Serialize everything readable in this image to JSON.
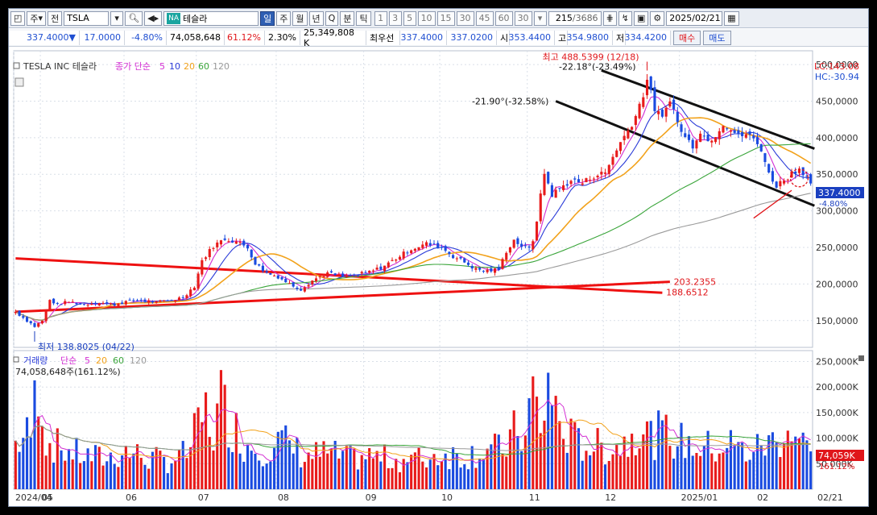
{
  "toolbar": {
    "period_label": "주",
    "prev_label": "전",
    "symbol": "TSLA",
    "na_badge": "NA",
    "name": "테슬라",
    "periods": [
      "일",
      "주",
      "월",
      "년",
      "Q",
      "분",
      "틱"
    ],
    "selected_period": "일",
    "intervals": [
      "1",
      "3",
      "5",
      "10",
      "15",
      "30",
      "45",
      "60",
      "30"
    ],
    "bar_count": "215",
    "bar_total": "/3686",
    "date": "2025/02/21"
  },
  "quote": {
    "price": "337.4000",
    "change": "17.0000",
    "change_pct": "-4.80%",
    "volume": "74,058,648",
    "vol_ratio": "61.12%",
    "turnover": "2.30%",
    "amount": "25,349,808 K",
    "best_label": "최우선",
    "ask": "337.4000",
    "bid": "337.0200",
    "open_label": "시",
    "open": "353.4400",
    "high_label": "고",
    "high": "354.9800",
    "low_label": "저",
    "low": "334.4200",
    "buy_label": "매수",
    "sell_label": "매도"
  },
  "colors": {
    "up": "#e81b1b",
    "down": "#1a4be0",
    "ma5": "#d32fd3",
    "ma10": "#2a3bd8",
    "ma20": "#f2a21b",
    "ma60": "#3aa53a",
    "ma120": "#9a9a9a"
  },
  "price_panel": {
    "title": "TESLA INC  테슬라",
    "ma_label": "종가 단순",
    "ma_periods": [
      "5",
      "10",
      "20",
      "60",
      "120"
    ],
    "lc": "LC:143.08",
    "hc": "HC:-30.94",
    "current_price": "337.4000",
    "current_pct": "-4.80%",
    "annot_high": "최고 488.5399 (12/18)",
    "annot_low": "최저 138.8025 (04/22)",
    "annot_ch1": "-22.18°(-23.49%)",
    "annot_ch2": "-21.90°(-32.58%)",
    "annot_l1": "203.2355",
    "annot_l2": "188.6512"
  },
  "volume_panel": {
    "title": "거래량",
    "ma_label": "단순",
    "ma_periods": [
      "5",
      "20",
      "60",
      "120"
    ],
    "value_text": "74,058,648주(161.12%)",
    "current_label": "74,059K",
    "current_pct": "161.12%",
    "y_labels": [
      "250,000K",
      "200,000K",
      "150,000K",
      "100,000K",
      "50,000K"
    ]
  },
  "x_labels": [
    "2024/04",
    "05",
    "06",
    "07",
    "08",
    "09",
    "10",
    "11",
    "12",
    "2025/01",
    "02",
    "02/21"
  ],
  "chart_data": {
    "type": "candlestick",
    "title": "TESLA INC  테슬라",
    "ylim": [
      120,
      510
    ],
    "y_ticks": [
      150,
      200,
      250,
      300,
      350,
      400,
      450,
      500
    ],
    "vol_ylim": [
      0,
      265000
    ],
    "vol_ticks": [
      50000,
      100000,
      150000,
      200000,
      250000
    ],
    "months": [
      {
        "label": "2024/04",
        "start": 0
      },
      {
        "label": "05",
        "start": 7
      },
      {
        "label": "06",
        "start": 29
      },
      {
        "label": "07",
        "start": 48
      },
      {
        "label": "08",
        "start": 69
      },
      {
        "label": "09",
        "start": 92
      },
      {
        "label": "10",
        "start": 112
      },
      {
        "label": "11",
        "start": 135
      },
      {
        "label": "12",
        "start": 155
      },
      {
        "label": "2025/01",
        "start": 175
      },
      {
        "label": "02",
        "start": 195
      }
    ],
    "close_path": [
      [
        0,
        162
      ],
      [
        3,
        150
      ],
      [
        5,
        142
      ],
      [
        7,
        150
      ],
      [
        9,
        178
      ],
      [
        11,
        172
      ],
      [
        14,
        176
      ],
      [
        18,
        172
      ],
      [
        22,
        175
      ],
      [
        26,
        172
      ],
      [
        29,
        176
      ],
      [
        33,
        178
      ],
      [
        37,
        175
      ],
      [
        41,
        178
      ],
      [
        44,
        182
      ],
      [
        47,
        197
      ],
      [
        49,
        232
      ],
      [
        52,
        252
      ],
      [
        55,
        262
      ],
      [
        58,
        258
      ],
      [
        61,
        250
      ],
      [
        63,
        228
      ],
      [
        66,
        215
      ],
      [
        69,
        210
      ],
      [
        72,
        200
      ],
      [
        75,
        193
      ],
      [
        78,
        205
      ],
      [
        82,
        215
      ],
      [
        86,
        210
      ],
      [
        89,
        212
      ],
      [
        92,
        215
      ],
      [
        96,
        222
      ],
      [
        100,
        235
      ],
      [
        104,
        248
      ],
      [
        108,
        255
      ],
      [
        112,
        250
      ],
      [
        115,
        238
      ],
      [
        118,
        230
      ],
      [
        121,
        220
      ],
      [
        124,
        218
      ],
      [
        127,
        220
      ],
      [
        129,
        245
      ],
      [
        131,
        260
      ],
      [
        133,
        252
      ],
      [
        135,
        248
      ],
      [
        136,
        260
      ],
      [
        137,
        288
      ],
      [
        138,
        320
      ],
      [
        139,
        352
      ],
      [
        141,
        322
      ],
      [
        143,
        330
      ],
      [
        146,
        342
      ],
      [
        149,
        338
      ],
      [
        152,
        348
      ],
      [
        155,
        352
      ],
      [
        158,
        385
      ],
      [
        161,
        410
      ],
      [
        163,
        430
      ],
      [
        165,
        460
      ],
      [
        166,
        480
      ],
      [
        168,
        440
      ],
      [
        170,
        425
      ],
      [
        172,
        455
      ],
      [
        174,
        420
      ],
      [
        176,
        400
      ],
      [
        178,
        390
      ],
      [
        180,
        410
      ],
      [
        182,
        395
      ],
      [
        184,
        405
      ],
      [
        186,
        420
      ],
      [
        188,
        412
      ],
      [
        190,
        402
      ],
      [
        192,
        405
      ],
      [
        194,
        398
      ],
      [
        196,
        385
      ],
      [
        198,
        350
      ],
      [
        200,
        335
      ],
      [
        202,
        342
      ],
      [
        204,
        352
      ],
      [
        206,
        358
      ],
      [
        208,
        348
      ],
      [
        209,
        337.4
      ]
    ],
    "volume_path": [
      [
        0,
        90000
      ],
      [
        4,
        110000
      ],
      [
        6,
        230000
      ],
      [
        8,
        95000
      ],
      [
        12,
        80000
      ],
      [
        18,
        65000
      ],
      [
        24,
        60000
      ],
      [
        29,
        75000
      ],
      [
        35,
        60000
      ],
      [
        40,
        55000
      ],
      [
        45,
        70000
      ],
      [
        48,
        120000
      ],
      [
        50,
        150000
      ],
      [
        52,
        110000
      ],
      [
        54,
        175000
      ],
      [
        56,
        140000
      ],
      [
        60,
        90000
      ],
      [
        66,
        80000
      ],
      [
        70,
        95000
      ],
      [
        76,
        65000
      ],
      [
        82,
        70000
      ],
      [
        88,
        60000
      ],
      [
        92,
        65000
      ],
      [
        100,
        58000
      ],
      [
        108,
        60000
      ],
      [
        112,
        70000
      ],
      [
        118,
        65000
      ],
      [
        124,
        80000
      ],
      [
        128,
        75000
      ],
      [
        132,
        120000
      ],
      [
        134,
        95000
      ],
      [
        136,
        205000
      ],
      [
        138,
        100000
      ],
      [
        140,
        215000
      ],
      [
        142,
        150000
      ],
      [
        144,
        110000
      ],
      [
        148,
        90000
      ],
      [
        152,
        85000
      ],
      [
        156,
        80000
      ],
      [
        160,
        90000
      ],
      [
        163,
        120000
      ],
      [
        165,
        130000
      ],
      [
        167,
        100000
      ],
      [
        170,
        110000
      ],
      [
        174,
        95000
      ],
      [
        178,
        85000
      ],
      [
        184,
        80000
      ],
      [
        188,
        90000
      ],
      [
        192,
        70000
      ],
      [
        196,
        85000
      ],
      [
        200,
        95000
      ],
      [
        203,
        120000
      ],
      [
        206,
        95000
      ],
      [
        209,
        74059
      ]
    ],
    "trendlines": [
      {
        "name": "channel-upper",
        "color": "#111",
        "width": 3,
        "p1": [
          154,
          492
        ],
        "p2": [
          210,
          385
        ]
      },
      {
        "name": "channel-lower",
        "color": "#111",
        "width": 3,
        "p1": [
          142,
          450
        ],
        "p2": [
          210,
          307
        ]
      },
      {
        "name": "support-falling",
        "color": "#ee1111",
        "width": 3,
        "p1": [
          0,
          235
        ],
        "p2": [
          170,
          188
        ]
      },
      {
        "name": "support-rising",
        "color": "#ee1111",
        "width": 3,
        "p1": [
          0,
          162
        ],
        "p2": [
          172,
          203
        ]
      }
    ],
    "circle": {
      "center": [
        206,
        345
      ],
      "r": 11
    },
    "arrow": {
      "from": [
        194,
        290
      ],
      "to": [
        204,
        328
      ]
    },
    "high_marker": {
      "index": 166,
      "value": 488.5
    },
    "low_marker": {
      "index": 5,
      "value": 138.8
    }
  }
}
